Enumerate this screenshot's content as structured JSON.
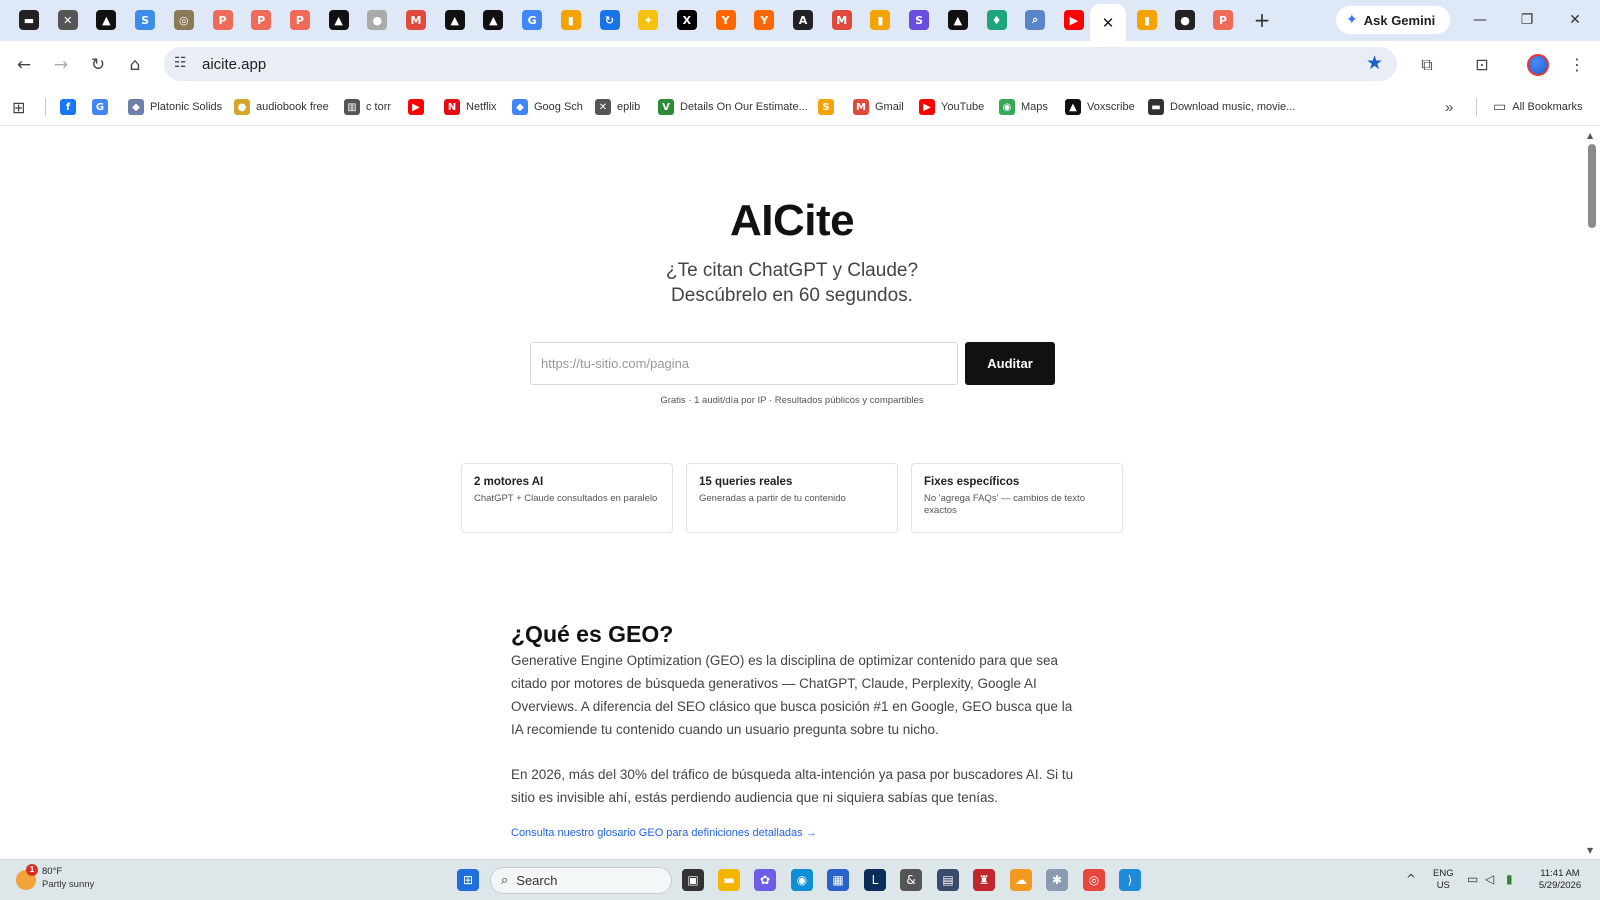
{
  "browser": {
    "tab_favicons": [
      {
        "icon": "printer-icon",
        "glyph": "▬",
        "color": "#222222"
      },
      {
        "icon": "bird-icon",
        "glyph": "✕",
        "color": "#555555"
      },
      {
        "icon": "triangle-logo-icon",
        "glyph": "▲",
        "color": "#111111"
      },
      {
        "icon": "sigo-icon",
        "glyph": "S",
        "color": "#3b8ee8"
      },
      {
        "icon": "seal-icon",
        "glyph": "◎",
        "color": "#8a7a55"
      },
      {
        "icon": "p-icon",
        "glyph": "P",
        "color": "#f06a5a"
      },
      {
        "icon": "p-icon",
        "glyph": "P",
        "color": "#f06a5a"
      },
      {
        "icon": "p-icon",
        "glyph": "P",
        "color": "#f06a5a"
      },
      {
        "icon": "triangle-logo-icon",
        "glyph": "▲",
        "color": "#111111"
      },
      {
        "icon": "globe-icon",
        "glyph": "●",
        "color": "#aaaaaa"
      },
      {
        "icon": "gmail-icon",
        "glyph": "M",
        "color": "#e04a3a"
      },
      {
        "icon": "triangle-logo-icon",
        "glyph": "▲",
        "color": "#111111"
      },
      {
        "icon": "triangle-logo-icon",
        "glyph": "▲",
        "color": "#111111"
      },
      {
        "icon": "google-icon",
        "glyph": "G",
        "color": "#4285f4"
      },
      {
        "icon": "analytics-icon",
        "glyph": "▮",
        "color": "#f4a300"
      },
      {
        "icon": "refresh-logo-icon",
        "glyph": "↻",
        "color": "#1a73e8"
      },
      {
        "icon": "pin-icon",
        "glyph": "✦",
        "color": "#f4c20d"
      },
      {
        "icon": "x-icon",
        "glyph": "X",
        "color": "#000000"
      },
      {
        "icon": "ycombinator-icon",
        "glyph": "Y",
        "color": "#ff6600"
      },
      {
        "icon": "ycombinator-icon",
        "glyph": "Y",
        "color": "#ff6600"
      },
      {
        "icon": "anthropic-icon",
        "glyph": "A",
        "color": "#222222"
      },
      {
        "icon": "gmail-icon",
        "glyph": "M",
        "color": "#e04a3a"
      },
      {
        "icon": "analytics-icon",
        "glyph": "▮",
        "color": "#f4a300"
      },
      {
        "icon": "s-icon",
        "glyph": "S",
        "color": "#6a4ce0"
      },
      {
        "icon": "triangle-logo-icon",
        "glyph": "▲",
        "color": "#111111"
      },
      {
        "icon": "shield-icon",
        "glyph": "♦",
        "color": "#1ea57c"
      },
      {
        "icon": "search-icon",
        "glyph": "⌕",
        "color": "#5a86c9"
      },
      {
        "icon": "youtube-icon",
        "glyph": "▶",
        "color": "#ff0000"
      }
    ],
    "tab_favicons_right": [
      {
        "icon": "analytics-icon",
        "glyph": "▮",
        "color": "#f4a300"
      },
      {
        "icon": "github-icon",
        "glyph": "●",
        "color": "#222222"
      },
      {
        "icon": "p-icon",
        "glyph": "P",
        "color": "#f06a5a"
      }
    ],
    "active_tab_close": "✕",
    "new_tab_glyph": "+",
    "ask_gemini": "Ask Gemini",
    "window_controls": {
      "minimize": "—",
      "restore": "❐",
      "close": "✕"
    },
    "url": "aicite.app"
  },
  "bookmarks": [
    {
      "label": "",
      "icon": "facebook-icon",
      "glyph": "f",
      "color": "#1877f2"
    },
    {
      "label": "",
      "icon": "google-icon",
      "glyph": "G",
      "color": "#4285f4"
    },
    {
      "label": "Platonic Solids",
      "icon": "solids-icon",
      "glyph": "◆",
      "color": "#6b7fa8"
    },
    {
      "label": "audiobook free",
      "icon": "audiobook-icon",
      "glyph": "●",
      "color": "#d4a72c"
    },
    {
      "label": "c torr",
      "icon": "torrent-icon",
      "glyph": "▥",
      "color": "#555555"
    },
    {
      "label": "",
      "icon": "youtube-icon",
      "glyph": "▶",
      "color": "#ff0000"
    },
    {
      "label": "Netflix",
      "icon": "netflix-icon",
      "glyph": "N",
      "color": "#e50914"
    },
    {
      "label": "Goog Sch",
      "icon": "scholar-icon",
      "glyph": "◆",
      "color": "#4285f4"
    },
    {
      "label": "eplib",
      "icon": "bird-icon",
      "glyph": "✕",
      "color": "#555555"
    },
    {
      "label": "Details On Our Estimate...",
      "icon": "v-logo-icon",
      "glyph": "V",
      "color": "#2e8b3a"
    },
    {
      "label": "",
      "icon": "s-logo-icon",
      "glyph": "S",
      "color": "#f4a300"
    },
    {
      "label": "Gmail",
      "icon": "gmail-icon",
      "glyph": "M",
      "color": "#e04a3a"
    },
    {
      "label": "YouTube",
      "icon": "youtube-icon",
      "glyph": "▶",
      "color": "#ff0000"
    },
    {
      "label": "Maps",
      "icon": "maps-icon",
      "glyph": "◉",
      "color": "#34a853"
    },
    {
      "label": "Voxscribe",
      "icon": "triangle-logo-icon",
      "glyph": "▲",
      "color": "#111111"
    },
    {
      "label": "Download music, movie...",
      "icon": "download-icon",
      "glyph": "▬",
      "color": "#333333"
    }
  ],
  "bookmarks_overflow": "»",
  "all_bookmarks": "All Bookmarks",
  "page": {
    "title": "AICite",
    "subtitle_line1": "¿Te citan ChatGPT y Claude?",
    "subtitle_line2": "Descúbrelo en 60 segundos.",
    "input_placeholder": "https://tu-sitio.com/pagina",
    "audit_button": "Auditar",
    "hint": "Gratis · 1 audit/día por IP · Resultados públicos y compartibles",
    "cards": [
      {
        "title": "2 motores AI",
        "desc": "ChatGPT + Claude consultados en paralelo"
      },
      {
        "title": "15 queries reales",
        "desc": "Generadas a partir de tu contenido"
      },
      {
        "title": "Fixes específicos",
        "desc": "No 'agrega FAQs' — cambios de texto exactos"
      }
    ],
    "geo_title": "¿Qué es GEO?",
    "geo_p1": "Generative Engine Optimization (GEO) es la disciplina de optimizar contenido para que sea citado por motores de búsqueda generativos — ChatGPT, Claude, Perplexity, Google AI Overviews. A diferencia del SEO clásico que busca posición #1 en Google, GEO busca que la IA recomiende tu contenido cuando un usuario pregunta sobre tu nicho.",
    "geo_p2": "En 2026, más del 30% del tráfico de búsqueda alta-intención ya pasa por buscadores AI. Si tu sitio es invisible ahí, estás perdiendo audiencia que ni siquiera sabías que tenías.",
    "geo_link": "Consulta nuestro glosario GEO para definiciones detalladas →"
  },
  "taskbar": {
    "weather_temp": "80°F",
    "weather_desc": "Partly sunny",
    "weather_badge": "1",
    "search_label": "Search",
    "lang_line1": "ENG",
    "lang_line2": "US",
    "time": "11:41 AM",
    "date": "5/29/2026",
    "apps": [
      {
        "icon": "windows-start-icon",
        "glyph": "⊞",
        "color": "#1e6fd9"
      },
      {
        "icon": "task-view-icon",
        "glyph": "▣",
        "color": "#333333"
      },
      {
        "icon": "file-explorer-icon",
        "glyph": "▬",
        "color": "#f2b600"
      },
      {
        "icon": "copilot-icon",
        "glyph": "✿",
        "color": "#6d5de8"
      },
      {
        "icon": "edge-icon",
        "glyph": "◉",
        "color": "#0c8fd6"
      },
      {
        "icon": "store-icon",
        "glyph": "▦",
        "color": "#2a63c9"
      },
      {
        "icon": "lrc-icon",
        "glyph": "L",
        "color": "#0b2d59"
      },
      {
        "icon": "ampersand-app-icon",
        "glyph": "&",
        "color": "#555555"
      },
      {
        "icon": "video-editor-icon",
        "glyph": "▤",
        "color": "#3a4a6a"
      },
      {
        "icon": "shield-app-icon",
        "glyph": "♜",
        "color": "#c0262d"
      },
      {
        "icon": "cloud-icon",
        "glyph": "☁",
        "color": "#f29a1f"
      },
      {
        "icon": "mascot-app-icon",
        "glyph": "✱",
        "color": "#8a9bb0"
      },
      {
        "icon": "chrome-icon",
        "glyph": "◎",
        "color": "#e8453c"
      },
      {
        "icon": "vscode-icon",
        "glyph": "⟩",
        "color": "#1f8ad8"
      }
    ]
  }
}
